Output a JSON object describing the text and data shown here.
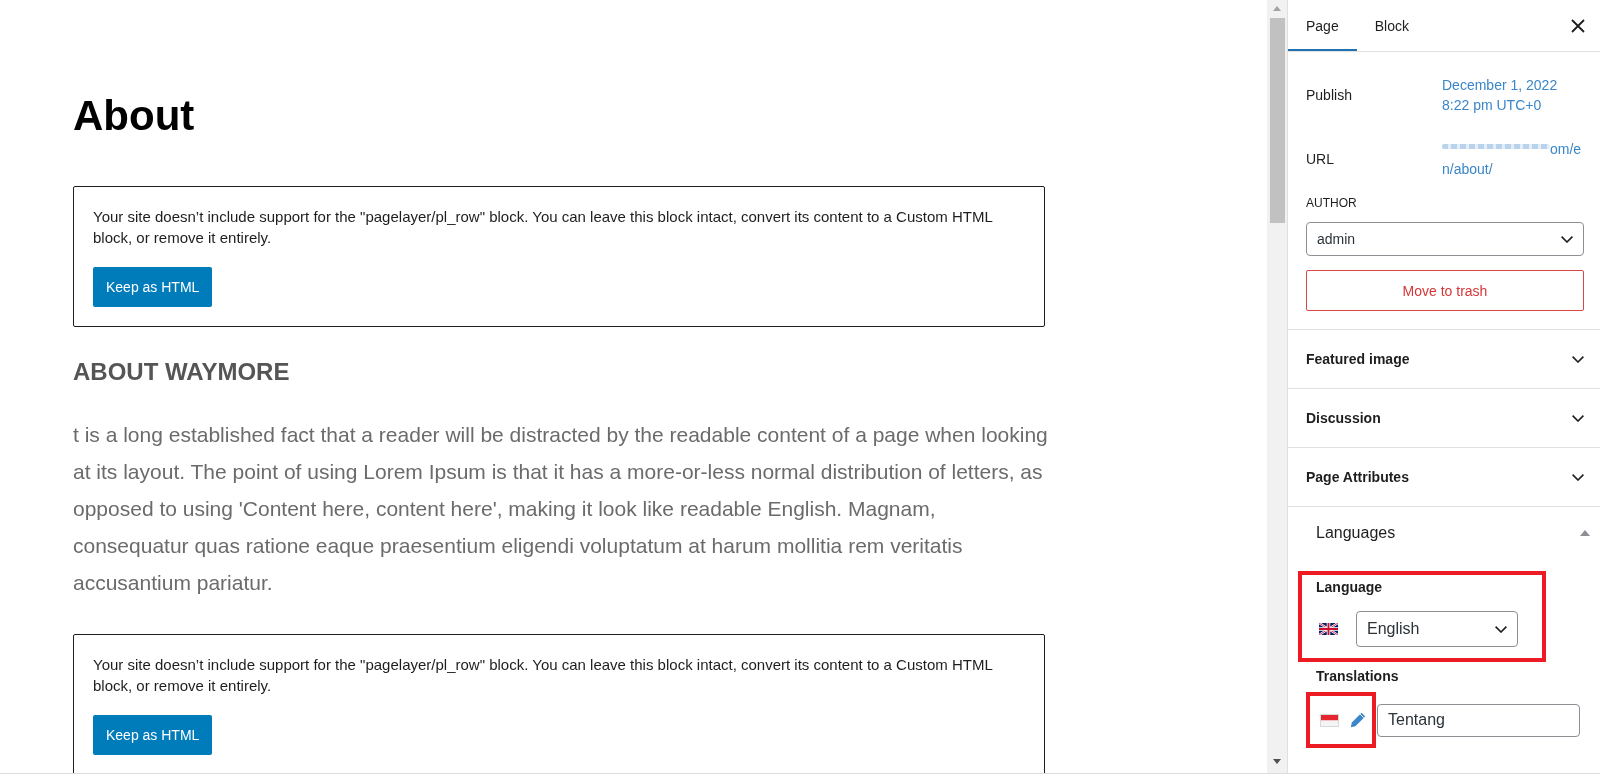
{
  "editor": {
    "title": "About",
    "blocks": [
      {
        "kind": "notice",
        "message": "Your site doesn’t include support for the \"pagelayer/pl_row\" block. You can leave this block intact, convert its content to a Custom HTML block, or remove it entirely.",
        "button": "Keep as HTML"
      },
      {
        "kind": "heading",
        "text": "ABOUT WAYMORE"
      },
      {
        "kind": "paragraph",
        "text": "t is a long established fact that a reader will be distracted by the readable content of a page when looking at its layout. The point of using Lorem Ipsum is that it has a more-or-less normal distribution of letters, as opposed to using 'Content here, content here', making it look like readable English. Magnam, consequatur quas ratione eaque praesentium eligendi voluptatum at harum mollitia rem veritatis accusantium pariatur."
      },
      {
        "kind": "notice",
        "message": "Your site doesn’t include support for the \"pagelayer/pl_row\" block. You can leave this block intact, convert its content to a Custom HTML block, or remove it entirely.",
        "button": "Keep as HTML"
      }
    ]
  },
  "sidebar": {
    "tabs": [
      {
        "label": "Page",
        "selected": true
      },
      {
        "label": "Block",
        "selected": false
      }
    ],
    "summary": {
      "rows": [
        {
          "label": "Publish",
          "value": "December 1, 2022 8:22 pm UTC+0",
          "obscured": false
        },
        {
          "label": "URL",
          "value": "om/en/about/",
          "obscured": true
        }
      ],
      "author": {
        "label": "AUTHOR",
        "value": "admin"
      },
      "trash_button": "Move to trash"
    },
    "panels": [
      {
        "title": "Featured image",
        "expanded": false
      },
      {
        "title": "Discussion",
        "expanded": false
      },
      {
        "title": "Page Attributes",
        "expanded": false
      },
      {
        "title": "Languages",
        "expanded": true,
        "language": {
          "label": "Language",
          "value": "English",
          "highlighted": true
        },
        "translations": {
          "label": "Translations",
          "items": [
            {
              "value": "Tentang",
              "highlighted": true
            }
          ]
        }
      }
    ]
  }
}
